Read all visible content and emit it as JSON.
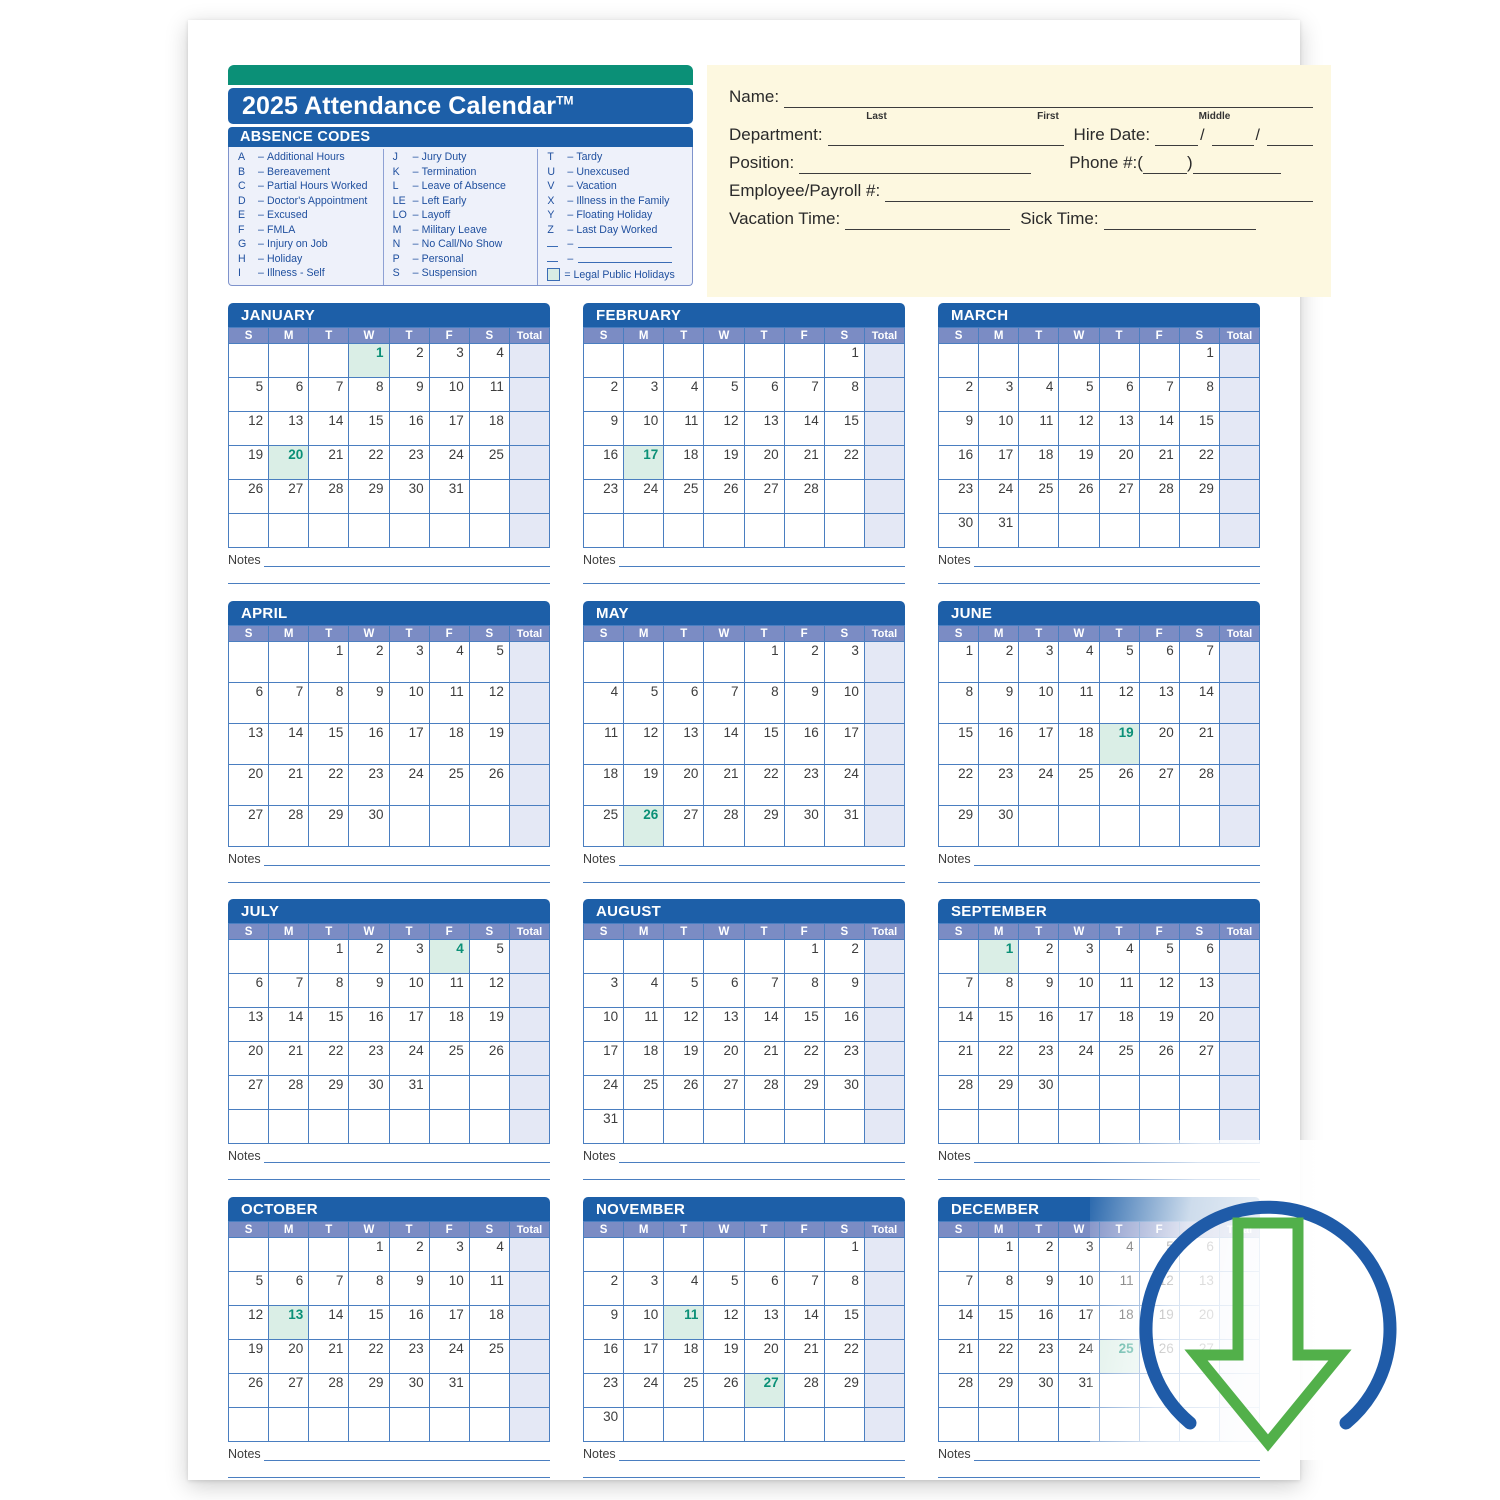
{
  "header": {
    "title": "2025 Attendance Calendar",
    "trademark": "TM",
    "codes_heading": "ABSENCE  CODES"
  },
  "absence_codes": {
    "column1": [
      {
        "key": "A",
        "dash": "–",
        "label": "Additional Hours"
      },
      {
        "key": "B",
        "dash": "–",
        "label": "Bereavement"
      },
      {
        "key": "C",
        "dash": "–",
        "label": "Partial Hours Worked"
      },
      {
        "key": "D",
        "dash": "–",
        "label": "Doctor's Appointment"
      },
      {
        "key": "E",
        "dash": "–",
        "label": "Excused"
      },
      {
        "key": "F",
        "dash": "–",
        "label": "FMLA"
      },
      {
        "key": "G",
        "dash": "–",
        "label": "Injury on Job"
      },
      {
        "key": "H",
        "dash": "–",
        "label": "Holiday"
      },
      {
        "key": "I",
        "dash": "–",
        "label": "Illness - Self"
      }
    ],
    "column2": [
      {
        "key": "J",
        "dash": "–",
        "label": "Jury Duty"
      },
      {
        "key": "K",
        "dash": "–",
        "label": "Termination"
      },
      {
        "key": "L",
        "dash": "–",
        "label": "Leave of Absence"
      },
      {
        "key": "LE",
        "dash": "–",
        "label": "Left Early"
      },
      {
        "key": "LO",
        "dash": "–",
        "label": "Layoff"
      },
      {
        "key": "M",
        "dash": "–",
        "label": "Military Leave"
      },
      {
        "key": "N",
        "dash": "–",
        "label": "No Call/No Show"
      },
      {
        "key": "P",
        "dash": "–",
        "label": "Personal"
      },
      {
        "key": "S",
        "dash": "–",
        "label": "Suspension"
      }
    ],
    "column3": [
      {
        "key": "T",
        "dash": "–",
        "label": "Tardy"
      },
      {
        "key": "U",
        "dash": "–",
        "label": "Unexcused"
      },
      {
        "key": "V",
        "dash": "–",
        "label": "Vacation"
      },
      {
        "key": "X",
        "dash": "–",
        "label": "Illness in the Family"
      },
      {
        "key": "Y",
        "dash": "–",
        "label": "Floating Holiday"
      },
      {
        "key": "Z",
        "dash": "–",
        "label": "Last Day Worked"
      }
    ],
    "legend_label": "= Legal Public Holidays"
  },
  "employee_form": {
    "name_label": "Name:",
    "sub_last": "Last",
    "sub_first": "First",
    "sub_middle": "Middle",
    "department_label": "Department:",
    "hire_date_label": "Hire Date:",
    "position_label": "Position:",
    "phone_label": "Phone #:",
    "payroll_label": "Employee/Payroll #:",
    "vacation_label": "Vacation Time:",
    "sick_label": "Sick Time:",
    "slash": "/",
    "paren_open": "(",
    "paren_close": ")"
  },
  "calendar": {
    "weekday_headers": [
      "S",
      "M",
      "T",
      "W",
      "T",
      "F",
      "S"
    ],
    "total_header": "Total",
    "notes_label": "Notes",
    "year": "2025",
    "months": [
      {
        "name": "JANUARY",
        "rows": [
          [
            "",
            "",
            "",
            "1",
            "2",
            "3",
            "4"
          ],
          [
            "5",
            "6",
            "7",
            "8",
            "9",
            "10",
            "11"
          ],
          [
            "12",
            "13",
            "14",
            "15",
            "16",
            "17",
            "18"
          ],
          [
            "19",
            "20",
            "21",
            "22",
            "23",
            "24",
            "25"
          ],
          [
            "26",
            "27",
            "28",
            "29",
            "30",
            "31",
            ""
          ],
          [
            "",
            "",
            "",
            "",
            "",
            "",
            ""
          ]
        ],
        "holidays": [
          "1",
          "20"
        ]
      },
      {
        "name": "FEBRUARY",
        "rows": [
          [
            "",
            "",
            "",
            "",
            "",
            "",
            "1"
          ],
          [
            "2",
            "3",
            "4",
            "5",
            "6",
            "7",
            "8"
          ],
          [
            "9",
            "10",
            "11",
            "12",
            "13",
            "14",
            "15"
          ],
          [
            "16",
            "17",
            "18",
            "19",
            "20",
            "21",
            "22"
          ],
          [
            "23",
            "24",
            "25",
            "26",
            "27",
            "28",
            ""
          ],
          [
            "",
            "",
            "",
            "",
            "",
            "",
            ""
          ]
        ],
        "holidays": [
          "17"
        ]
      },
      {
        "name": "MARCH",
        "rows": [
          [
            "",
            "",
            "",
            "",
            "",
            "",
            "1"
          ],
          [
            "2",
            "3",
            "4",
            "5",
            "6",
            "7",
            "8"
          ],
          [
            "9",
            "10",
            "11",
            "12",
            "13",
            "14",
            "15"
          ],
          [
            "16",
            "17",
            "18",
            "19",
            "20",
            "21",
            "22"
          ],
          [
            "23",
            "24",
            "25",
            "26",
            "27",
            "28",
            "29"
          ],
          [
            "30",
            "31",
            "",
            "",
            "",
            "",
            ""
          ]
        ],
        "holidays": []
      },
      {
        "name": "APRIL",
        "rows": [
          [
            "",
            "",
            "1",
            "2",
            "3",
            "4",
            "5"
          ],
          [
            "6",
            "7",
            "8",
            "9",
            "10",
            "11",
            "12"
          ],
          [
            "13",
            "14",
            "15",
            "16",
            "17",
            "18",
            "19"
          ],
          [
            "20",
            "21",
            "22",
            "23",
            "24",
            "25",
            "26"
          ],
          [
            "27",
            "28",
            "29",
            "30",
            "",
            "",
            ""
          ]
        ],
        "holidays": []
      },
      {
        "name": "MAY",
        "rows": [
          [
            "",
            "",
            "",
            "",
            "1",
            "2",
            "3"
          ],
          [
            "4",
            "5",
            "6",
            "7",
            "8",
            "9",
            "10"
          ],
          [
            "11",
            "12",
            "13",
            "14",
            "15",
            "16",
            "17"
          ],
          [
            "18",
            "19",
            "20",
            "21",
            "22",
            "23",
            "24"
          ],
          [
            "25",
            "26",
            "27",
            "28",
            "29",
            "30",
            "31"
          ]
        ],
        "holidays": [
          "26"
        ]
      },
      {
        "name": "JUNE",
        "rows": [
          [
            "1",
            "2",
            "3",
            "4",
            "5",
            "6",
            "7"
          ],
          [
            "8",
            "9",
            "10",
            "11",
            "12",
            "13",
            "14"
          ],
          [
            "15",
            "16",
            "17",
            "18",
            "19",
            "20",
            "21"
          ],
          [
            "22",
            "23",
            "24",
            "25",
            "26",
            "27",
            "28"
          ],
          [
            "29",
            "30",
            "",
            "",
            "",
            "",
            ""
          ]
        ],
        "holidays": [
          "19"
        ]
      },
      {
        "name": "JULY",
        "rows": [
          [
            "",
            "",
            "1",
            "2",
            "3",
            "4",
            "5"
          ],
          [
            "6",
            "7",
            "8",
            "9",
            "10",
            "11",
            "12"
          ],
          [
            "13",
            "14",
            "15",
            "16",
            "17",
            "18",
            "19"
          ],
          [
            "20",
            "21",
            "22",
            "23",
            "24",
            "25",
            "26"
          ],
          [
            "27",
            "28",
            "29",
            "30",
            "31",
            "",
            ""
          ],
          [
            "",
            "",
            "",
            "",
            "",
            "",
            ""
          ]
        ],
        "holidays": [
          "4"
        ]
      },
      {
        "name": "AUGUST",
        "rows": [
          [
            "",
            "",
            "",
            "",
            "",
            "1",
            "2"
          ],
          [
            "3",
            "4",
            "5",
            "6",
            "7",
            "8",
            "9"
          ],
          [
            "10",
            "11",
            "12",
            "13",
            "14",
            "15",
            "16"
          ],
          [
            "17",
            "18",
            "19",
            "20",
            "21",
            "22",
            "23"
          ],
          [
            "24",
            "25",
            "26",
            "27",
            "28",
            "29",
            "30"
          ],
          [
            "31",
            "",
            "",
            "",
            "",
            "",
            ""
          ]
        ],
        "holidays": []
      },
      {
        "name": "SEPTEMBER",
        "rows": [
          [
            "",
            "1",
            "2",
            "3",
            "4",
            "5",
            "6"
          ],
          [
            "7",
            "8",
            "9",
            "10",
            "11",
            "12",
            "13"
          ],
          [
            "14",
            "15",
            "16",
            "17",
            "18",
            "19",
            "20"
          ],
          [
            "21",
            "22",
            "23",
            "24",
            "25",
            "26",
            "27"
          ],
          [
            "28",
            "29",
            "30",
            "",
            "",
            "",
            ""
          ],
          [
            "",
            "",
            "",
            "",
            "",
            "",
            ""
          ]
        ],
        "holidays": [
          "1"
        ]
      },
      {
        "name": "OCTOBER",
        "rows": [
          [
            "",
            "",
            "",
            "1",
            "2",
            "3",
            "4"
          ],
          [
            "5",
            "6",
            "7",
            "8",
            "9",
            "10",
            "11"
          ],
          [
            "12",
            "13",
            "14",
            "15",
            "16",
            "17",
            "18"
          ],
          [
            "19",
            "20",
            "21",
            "22",
            "23",
            "24",
            "25"
          ],
          [
            "26",
            "27",
            "28",
            "29",
            "30",
            "31",
            ""
          ],
          [
            "",
            "",
            "",
            "",
            "",
            "",
            ""
          ]
        ],
        "holidays": [
          "13"
        ]
      },
      {
        "name": "NOVEMBER",
        "rows": [
          [
            "",
            "",
            "",
            "",
            "",
            "",
            "1"
          ],
          [
            "2",
            "3",
            "4",
            "5",
            "6",
            "7",
            "8"
          ],
          [
            "9",
            "10",
            "11",
            "12",
            "13",
            "14",
            "15"
          ],
          [
            "16",
            "17",
            "18",
            "19",
            "20",
            "21",
            "22"
          ],
          [
            "23",
            "24",
            "25",
            "26",
            "27",
            "28",
            "29"
          ],
          [
            "30",
            "",
            "",
            "",
            "",
            "",
            ""
          ]
        ],
        "holidays": [
          "11",
          "27"
        ]
      },
      {
        "name": "DECEMBER",
        "rows": [
          [
            "",
            "1",
            "2",
            "3",
            "4",
            "5",
            "6"
          ],
          [
            "7",
            "8",
            "9",
            "10",
            "11",
            "12",
            "13"
          ],
          [
            "14",
            "15",
            "16",
            "17",
            "18",
            "19",
            "20"
          ],
          [
            "21",
            "22",
            "23",
            "24",
            "25",
            "26",
            "27"
          ],
          [
            "28",
            "29",
            "30",
            "31",
            "",
            "",
            ""
          ],
          [
            "",
            "",
            "",
            "",
            "",
            "",
            ""
          ]
        ],
        "holidays": [
          "25"
        ]
      }
    ]
  },
  "colors": {
    "brand_blue": "#1d5fa8",
    "brand_green": "#0b9077",
    "header_purple": "#7b8cc4",
    "grid_blue": "#4a7ec0",
    "total_bg": "#e4e8f5",
    "holiday_bg": "#daeee6",
    "form_bg": "#fdf8e0",
    "download_circle": "#1f5ba8",
    "download_arrow": "#52b04a"
  },
  "overlay": {
    "icon_name": "download-icon"
  }
}
